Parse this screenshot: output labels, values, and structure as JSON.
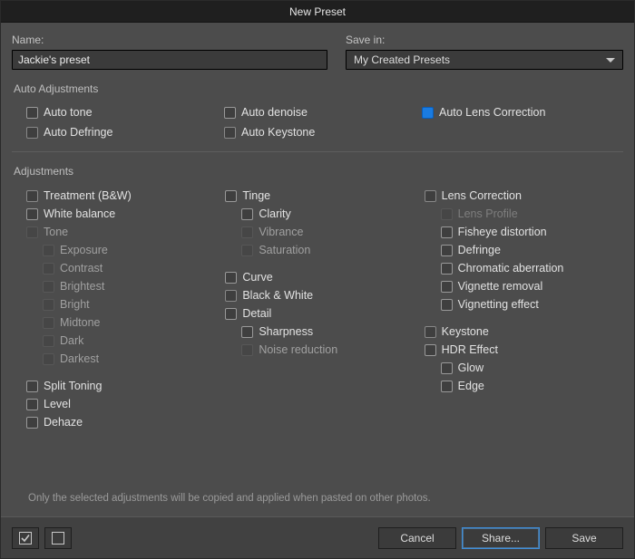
{
  "window": {
    "title": "New Preset"
  },
  "name": {
    "label": "Name:",
    "value": "Jackie's preset"
  },
  "save_in": {
    "label": "Save in:",
    "selected": "My Created Presets"
  },
  "sections": {
    "auto": "Auto Adjustments",
    "adjustments": "Adjustments"
  },
  "auto": {
    "auto_tone": "Auto tone",
    "auto_denoise": "Auto denoise",
    "auto_lens_correction": "Auto Lens Correction",
    "auto_defringe": "Auto Defringe",
    "auto_keystone": "Auto Keystone"
  },
  "adj": {
    "col1": {
      "treatment_bw": "Treatment (B&W)",
      "white_balance": "White balance",
      "tone": "Tone",
      "exposure": "Exposure",
      "contrast": "Contrast",
      "brightest": "Brightest",
      "bright": "Bright",
      "midtone": "Midtone",
      "dark": "Dark",
      "darkest": "Darkest",
      "split_toning": "Split Toning",
      "level": "Level",
      "dehaze": "Dehaze"
    },
    "col2": {
      "tinge": "Tinge",
      "clarity": "Clarity",
      "vibrance": "Vibrance",
      "saturation": "Saturation",
      "curve": "Curve",
      "black_white": "Black & White",
      "detail": "Detail",
      "sharpness": "Sharpness",
      "noise_reduction": "Noise reduction"
    },
    "col3": {
      "lens_correction": "Lens Correction",
      "lens_profile": "Lens Profile",
      "fisheye_distortion": "Fisheye distortion",
      "defringe": "Defringe",
      "chromatic_aberration": "Chromatic aberration",
      "vignette_removal": "Vignette removal",
      "vignetting_effect": "Vignetting effect",
      "keystone": "Keystone",
      "hdr_effect": "HDR Effect",
      "glow": "Glow",
      "edge": "Edge"
    }
  },
  "note": "Only the selected adjustments will be copied and applied when pasted on other photos.",
  "footer": {
    "cancel": "Cancel",
    "share": "Share...",
    "save": "Save"
  }
}
